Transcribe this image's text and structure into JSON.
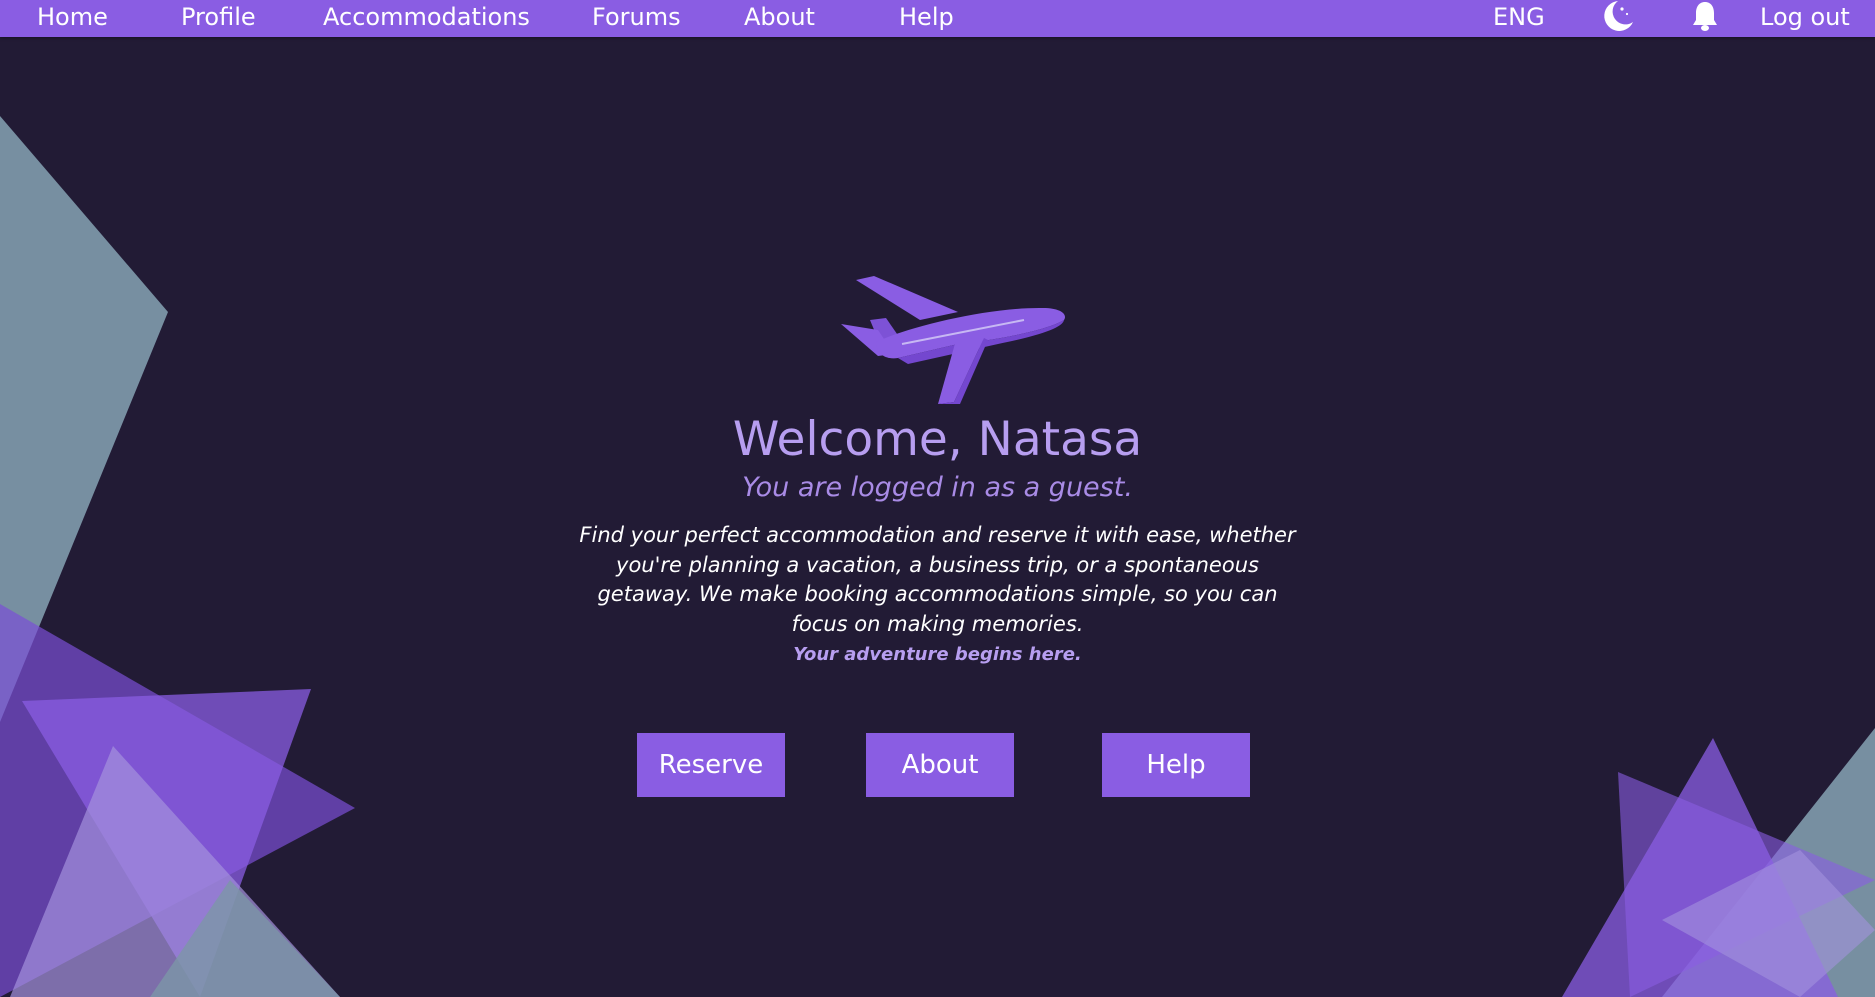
{
  "nav": {
    "home": "Home",
    "profile": "Profile",
    "accommodations": "Accommodations",
    "forums": "Forums",
    "about": "About",
    "help": "Help",
    "language": "ENG",
    "theme_icon": "moon-icon",
    "notifications_icon": "bell-icon",
    "logout": "Log out"
  },
  "hero": {
    "illustration_icon": "airplane-icon",
    "welcome": "Welcome, Natasa",
    "guest_notice": "You are logged in as a guest.",
    "description": "Find your perfect accommodation and reserve it with ease, whether you're planning a vacation, a business trip, or a spontaneous getaway. We make booking accommodations simple, so you can focus on making memories.",
    "tagline": "Your adventure begins here."
  },
  "buttons": {
    "reserve": "Reserve",
    "about": "About",
    "help": "Help"
  },
  "colors": {
    "accent": "#8a5de3",
    "background": "#221b35",
    "heading": "#b79ef0",
    "shape_gray": "#7c96a8",
    "shape_purple": "#8a5de3"
  }
}
